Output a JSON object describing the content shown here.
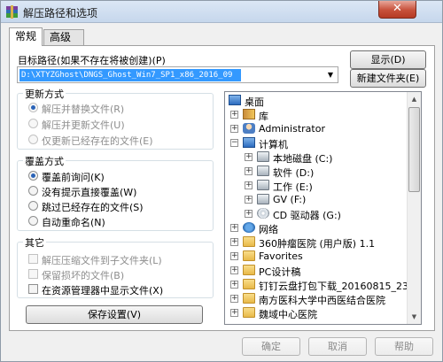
{
  "window": {
    "title": "解压路径和选项",
    "close_glyph": "✕"
  },
  "tabs": [
    {
      "label": "常规"
    },
    {
      "label": "高级"
    }
  ],
  "path": {
    "label": "目标路径(如果不存在将被创建)(P)",
    "value": "D:\\XTYZGhost\\DNGS_Ghost_Win7_SP1_x86_2016_09",
    "show_button": "显示(D)",
    "new_folder_button": "新建文件夹(E)"
  },
  "update_mode": {
    "title": "更新方式",
    "options": [
      {
        "label": "解压并替换文件(R)",
        "selected": true
      },
      {
        "label": "解压并更新文件(U)",
        "selected": false
      },
      {
        "label": "仅更新已经存在的文件(E)",
        "selected": false
      }
    ]
  },
  "overwrite_mode": {
    "title": "覆盖方式",
    "options": [
      {
        "label": "覆盖前询问(K)",
        "selected": true
      },
      {
        "label": "没有提示直接覆盖(W)",
        "selected": false
      },
      {
        "label": "跳过已经存在的文件(S)",
        "selected": false
      },
      {
        "label": "自动重命名(N)",
        "selected": false
      }
    ]
  },
  "misc": {
    "title": "其它",
    "options": [
      {
        "label": "解压压缩文件到子文件夹(L)",
        "checked": false
      },
      {
        "label": "保留损坏的文件(B)",
        "checked": false
      },
      {
        "label": "在资源管理器中显示文件(X)",
        "checked": false
      }
    ]
  },
  "save_settings_button": "保存设置(V)",
  "tree": {
    "nodes": [
      {
        "label": "桌面",
        "icon": "desktop-icon"
      },
      {
        "label": "库",
        "icon": "library-icon"
      },
      {
        "label": "Administrator",
        "icon": "user-icon"
      },
      {
        "label": "计算机",
        "icon": "computer-icon"
      },
      {
        "label": "本地磁盘 (C:)",
        "icon": "drive-icon"
      },
      {
        "label": "软件 (D:)",
        "icon": "drive-icon"
      },
      {
        "label": "工作 (E:)",
        "icon": "drive-icon"
      },
      {
        "label": "GV (F:)",
        "icon": "drive-icon"
      },
      {
        "label": "CD 驱动器 (G:)",
        "icon": "cd-drive-icon"
      },
      {
        "label": "网络",
        "icon": "network-icon"
      },
      {
        "label": "360肿瘤医院 (用户版) 1.1",
        "icon": "folder-icon"
      },
      {
        "label": "Favorites",
        "icon": "folder-icon"
      },
      {
        "label": "PC设计稿",
        "icon": "folder-icon"
      },
      {
        "label": "钉钉云盘打包下载_20160815_23_03",
        "icon": "folder-icon"
      },
      {
        "label": "南方医科大学中西医结合医院",
        "icon": "folder-icon"
      },
      {
        "label": "魏域中心医院",
        "icon": "folder-icon"
      }
    ]
  },
  "footer": {
    "ok": "确定",
    "cancel": "取消",
    "help": "帮助"
  }
}
